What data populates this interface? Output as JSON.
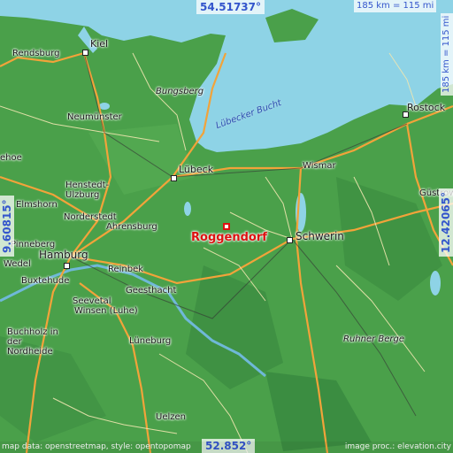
{
  "coords": {
    "top": "54.51737°",
    "bottom": "52.852°",
    "left": "9.60815°",
    "right": "12.42065°"
  },
  "scale": {
    "horizontal": "185 km = 115 mi",
    "vertical": "185 km = 115 mi"
  },
  "marker": {
    "label": "Roggendorf"
  },
  "water_labels": {
    "bay": "Lübecker Bucht"
  },
  "places": [
    {
      "name": "Kiel"
    },
    {
      "name": "Rendsburg"
    },
    {
      "name": "Bungsberg"
    },
    {
      "name": "Neumünster"
    },
    {
      "name": "Rostock"
    },
    {
      "name": "Lübeck"
    },
    {
      "name": "Wismar"
    },
    {
      "name": "Güstrow"
    },
    {
      "name": "ehoe"
    },
    {
      "name": "Henstedt-Ulzburg"
    },
    {
      "name": "Elmshorn"
    },
    {
      "name": "Norderstedt"
    },
    {
      "name": "Ahrensburg"
    },
    {
      "name": "Schwerin"
    },
    {
      "name": "Pinneberg"
    },
    {
      "name": "Hamburg"
    },
    {
      "name": "Wedel"
    },
    {
      "name": "Reinbek"
    },
    {
      "name": "Buxtehude"
    },
    {
      "name": "Geesthacht"
    },
    {
      "name": "Seevetal"
    },
    {
      "name": "Winsen (Luhe)"
    },
    {
      "name": "Buchholz in der Nordheide"
    },
    {
      "name": "Lüneburg"
    },
    {
      "name": "Ruhner Berge"
    },
    {
      "name": "Uelzen"
    }
  ],
  "credits": {
    "left": "map data: openstreetmap, style: opentopomap",
    "right": "image proc.: elevation.city"
  },
  "colors": {
    "sea": "#8ed3e6",
    "land": "#4aa04a",
    "highland": "#2f7d3a",
    "road_major": "#f2a33a",
    "road_minor": "#e8e2a0",
    "marker": "#dd1111",
    "coord_text": "#3355cc"
  }
}
